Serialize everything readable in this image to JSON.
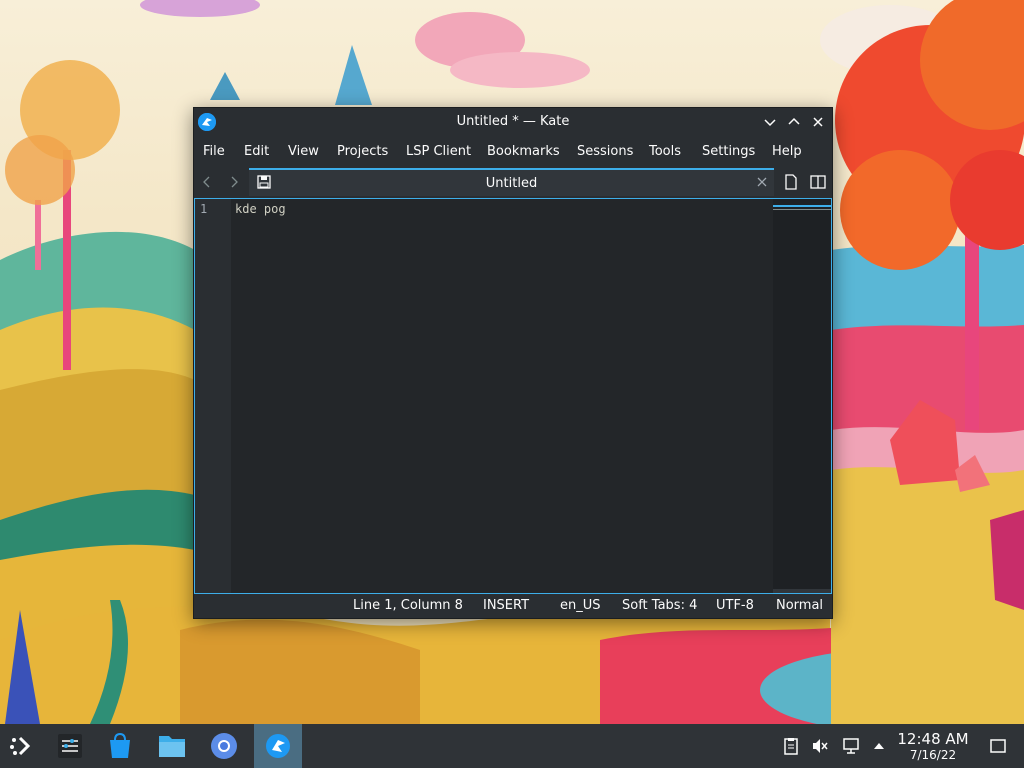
{
  "window": {
    "title": "Untitled * — Kate",
    "app_icon": "kate-icon"
  },
  "menubar": {
    "items": [
      "File",
      "Edit",
      "View",
      "Projects",
      "LSP Client",
      "Bookmarks",
      "Sessions",
      "Tools",
      "Settings",
      "Help"
    ]
  },
  "tabs": [
    {
      "label": "Untitled",
      "icons": [
        "save-icon",
        "close-icon"
      ]
    }
  ],
  "editor": {
    "line_number": "1",
    "content": "kde pog"
  },
  "statusbar": {
    "position": "Line 1, Column 8",
    "mode": "INSERT",
    "language": "en_US",
    "indent": "Soft Tabs: 4",
    "encoding": "UTF-8",
    "syntax": "Normal"
  },
  "taskbar": {
    "apps": [
      "application-launcher-icon",
      "system-settings-icon",
      "discover-store-icon",
      "file-manager-icon",
      "chromium-browser-icon",
      "kate-icon"
    ],
    "tray": [
      "clipboard-icon",
      "volume-muted-icon",
      "network-icon",
      "expand-tray-icon"
    ],
    "clock": {
      "time": "12:48 AM",
      "date": "7/16/22"
    }
  },
  "colors": {
    "accent": "#3daee9",
    "window_bg": "#2a2e32",
    "editor_bg": "#232629",
    "taskbar_bg": "#2f3337"
  }
}
